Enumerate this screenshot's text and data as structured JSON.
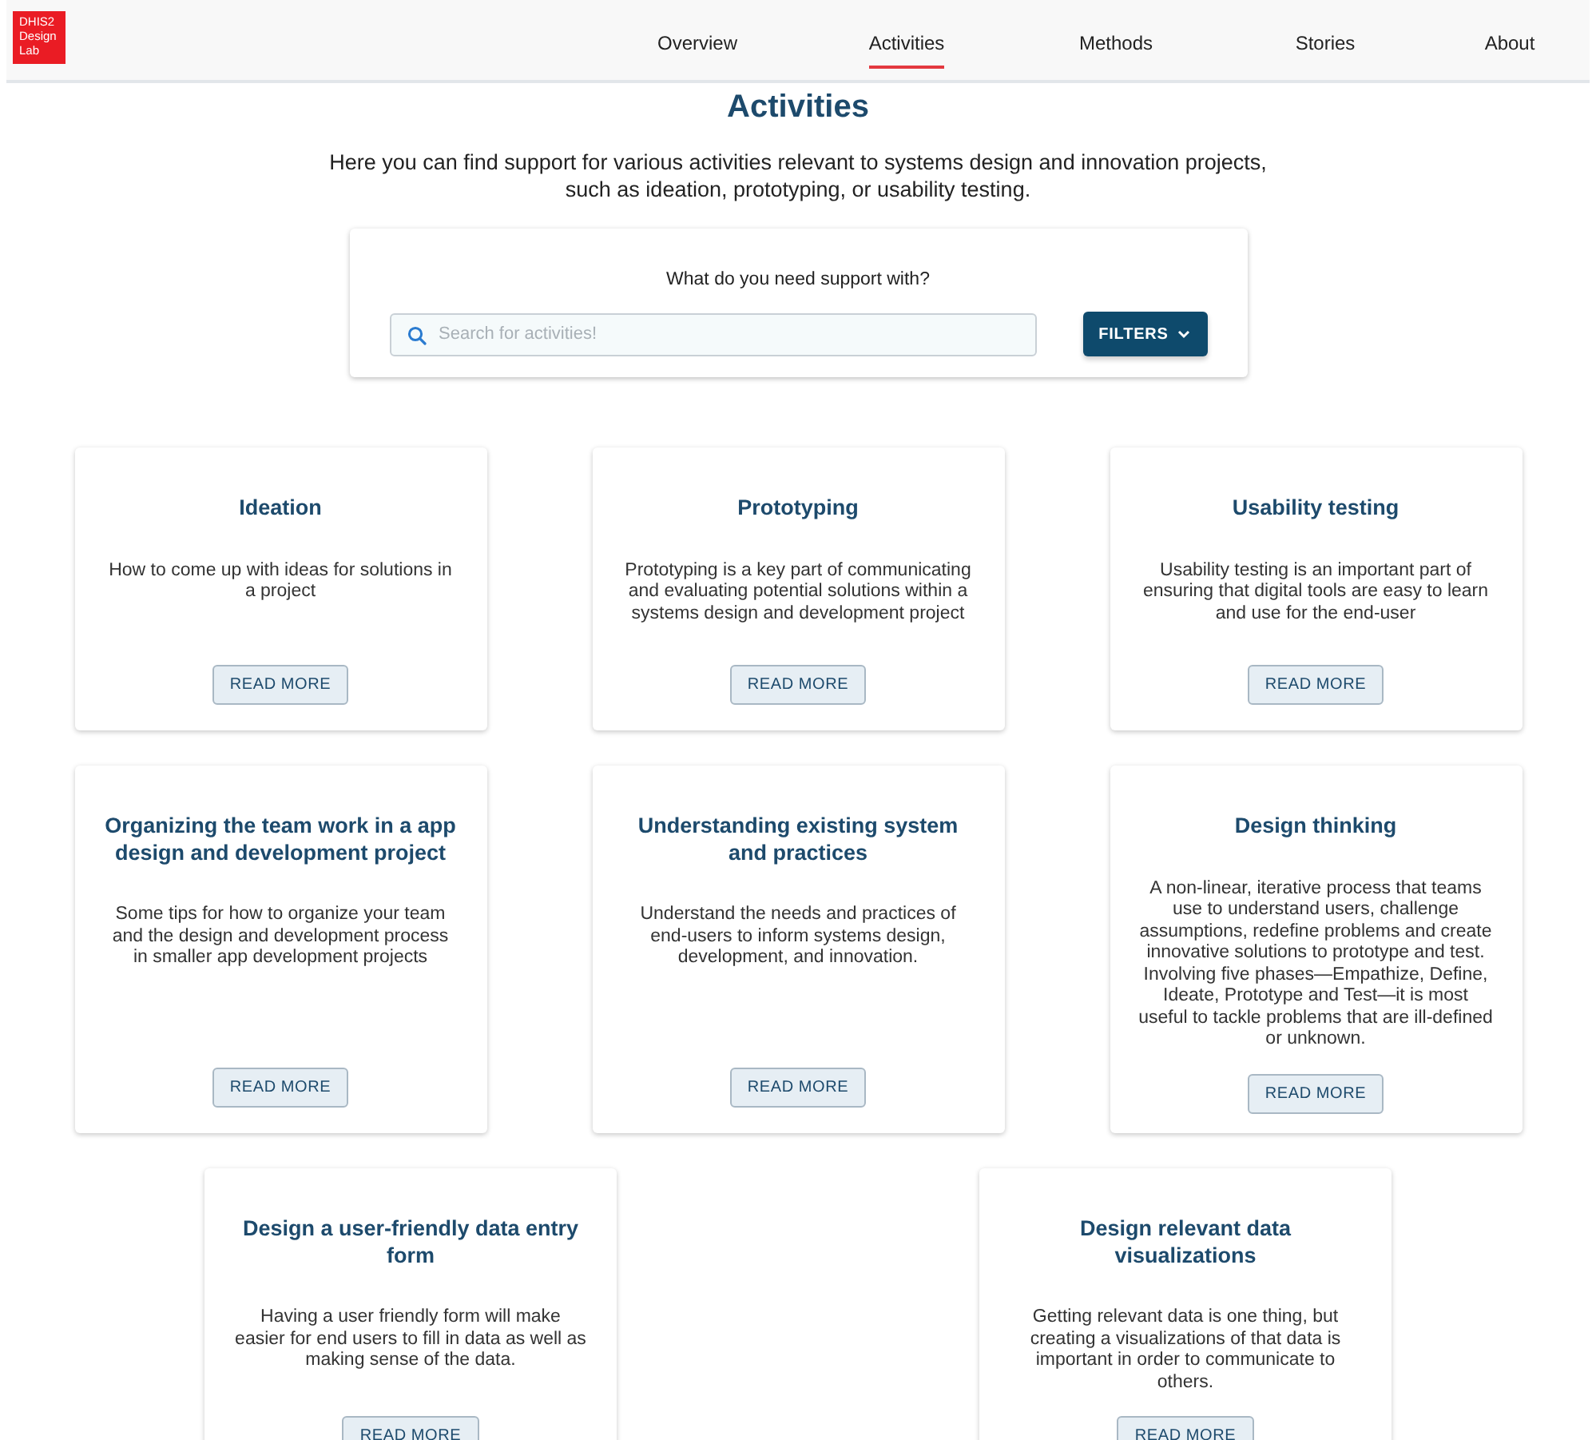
{
  "logo": {
    "text": "DHIS2 Design Lab"
  },
  "nav": [
    {
      "label": "Overview",
      "selected": false
    },
    {
      "label": "Activities",
      "selected": true
    },
    {
      "label": "Methods",
      "selected": false
    },
    {
      "label": "Stories",
      "selected": false
    },
    {
      "label": "About",
      "selected": false
    }
  ],
  "heading": "Activities",
  "intro": "Here you can find support for various activities relevant to systems design and innovation projects, such as ideation, prototyping, or usability testing.",
  "search": {
    "prompt": "What do you need support with?",
    "placeholder": "Search for activities!",
    "filters_button": "FILTERS"
  },
  "card_rows": [
    [
      {
        "title": "Ideation",
        "description": "How to come up with ideas for solutions in a project",
        "button": "READ MORE"
      },
      {
        "title": "Prototyping",
        "description": "Prototyping is a key part of communicating and evaluating potential solutions within a systems design and development project",
        "button": "READ MORE"
      },
      {
        "title": "Usability testing",
        "description": "Usability testing is an important part of ensuring that digital tools are easy to learn and use for the end-user",
        "button": "READ MORE"
      }
    ],
    [
      {
        "title": "Organizing the team work in a app design and development project",
        "description": "Some tips for how to organize your team and the design and development process in smaller app development projects",
        "button": "READ MORE"
      },
      {
        "title": "Understanding existing system and practices",
        "description": "Understand the needs and practices of end-users to inform systems design, development, and innovation.",
        "button": "READ MORE"
      },
      {
        "title": "Design thinking",
        "description": "A non-linear, iterative process that teams use to understand users, challenge assumptions, redefine problems and create innovative solutions to prototype and test. Involving five phases—Empathize, Define, Ideate, Prototype and Test—it is most useful to tackle problems that are ill-defined or unknown.",
        "button": "READ MORE"
      }
    ],
    [
      {
        "title": "Design a user-friendly data entry form",
        "description": "Having a user friendly form will make easier for end users to fill in data as well as making sense of the data.",
        "button": "READ MORE"
      },
      {
        "title": "Design relevant data visualizations",
        "description": "Getting relevant data is one thing, but creating a visualizations of that data is important in order to communicate to others.",
        "button": "READ MORE"
      }
    ]
  ]
}
